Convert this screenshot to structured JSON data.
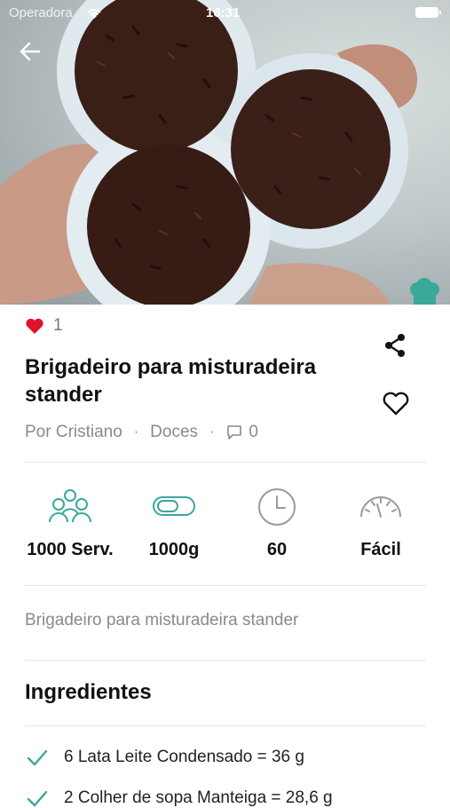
{
  "status_bar": {
    "carrier": "Operadora",
    "time": "16:31"
  },
  "recipe": {
    "likes": "1",
    "title": "Brigadeiro para misturadeira stander",
    "author": "Por Cristiano",
    "category": "Doces",
    "comments": "0",
    "description": "Brigadeiro para misturadeira stander"
  },
  "stats": {
    "servings": "1000 Serv.",
    "weight": "1000g",
    "time": "60",
    "difficulty": "Fácil"
  },
  "ingredients": {
    "title": "Ingredientes",
    "items": [
      "6 Lata Leite Condensado = 36 g",
      "2 Colher de sopa Manteiga = 28,6 g"
    ]
  },
  "colors": {
    "accent": "#3aa89a",
    "heart": "#e0112b"
  }
}
